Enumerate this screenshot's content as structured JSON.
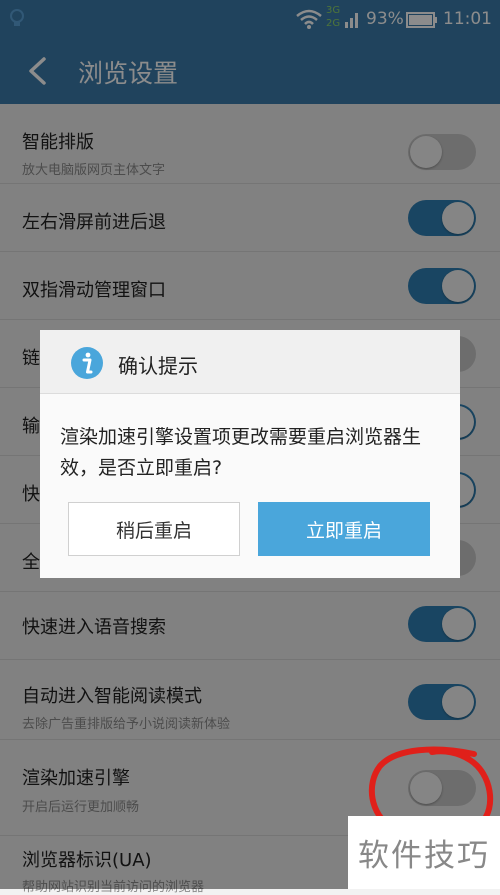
{
  "status_bar": {
    "network_top": "3G",
    "network_bottom": "2G",
    "battery_percent": "93%",
    "time": "11:01"
  },
  "app_bar": {
    "title": "浏览设置",
    "back_icon": "chevron-left-icon"
  },
  "settings": [
    {
      "label": "智能排版",
      "sub": "放大电脑版网页主体文字",
      "enabled": false
    },
    {
      "label": "左右滑屏前进后退",
      "sub": "",
      "enabled": true
    },
    {
      "label": "双指滑动管理窗口",
      "sub": "",
      "enabled": true
    },
    {
      "label": "链",
      "sub": "",
      "enabled": false
    },
    {
      "label": "输",
      "sub": "",
      "enabled": true
    },
    {
      "label": "快",
      "sub": "",
      "enabled": true
    },
    {
      "label": "全",
      "sub": "",
      "enabled": false
    },
    {
      "label": "快速进入语音搜索",
      "sub": "",
      "enabled": true
    },
    {
      "label": "自动进入智能阅读模式",
      "sub": "去除广告重排版给予小说阅读新体验",
      "enabled": true
    },
    {
      "label": "渲染加速引擎",
      "sub": "开启后运行更加顺畅",
      "enabled": false
    },
    {
      "label": "浏览器标识(UA)",
      "sub": "帮助网站识别当前访问的浏览器",
      "enabled": null
    }
  ],
  "dialog": {
    "title": "确认提示",
    "icon": "info-icon",
    "message": "渲染加速引擎设置项更改需要重启浏览器生效，是否立即重启?",
    "later_button": "稍后重启",
    "now_button": "立即重启"
  },
  "watermark": "软件技巧",
  "colors": {
    "header": "#3b7ba9",
    "toggle_on": "#2f7fb3",
    "primary_button": "#4aa6db",
    "annotation": "#e0201a"
  }
}
